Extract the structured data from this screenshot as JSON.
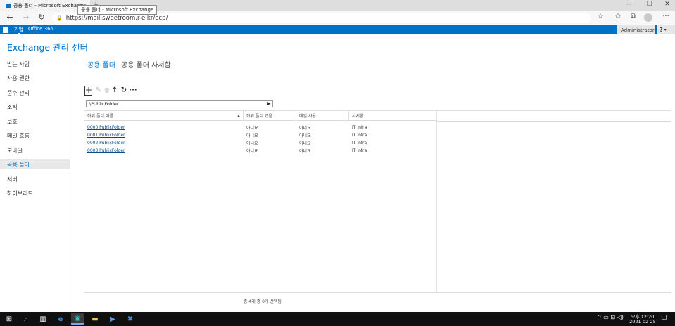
{
  "browser": {
    "tab_title": "공용 폴더 - Microsoft Exchange",
    "tooltip": "공용 폴더 - Microsoft Exchange",
    "url": "https://mail.sweetroom.r-e.kr/ecp/"
  },
  "o365": {
    "enterprise": "기업",
    "office": "Office 365",
    "user": "Administrator",
    "help": "?"
  },
  "app": {
    "title": "Exchange 관리 센터"
  },
  "nav": {
    "items": [
      {
        "label": "받는 사람"
      },
      {
        "label": "사용 권한"
      },
      {
        "label": "준수 관리"
      },
      {
        "label": "조직"
      },
      {
        "label": "보호"
      },
      {
        "label": "메일 흐름"
      },
      {
        "label": "모바일"
      },
      {
        "label": "공용 폴더"
      },
      {
        "label": "서버"
      },
      {
        "label": "하이브리드"
      }
    ],
    "active_index": 7
  },
  "tabs": {
    "public_folders": "공용 폴더",
    "public_mailboxes": "공용 폴더 사서함"
  },
  "toolbar": {
    "add": "+",
    "edit": "✎",
    "delete": "🗑",
    "up": "↑",
    "refresh": "↻",
    "more": "···"
  },
  "breadcrumb": "\\PublicFolder",
  "grid": {
    "columns": [
      "하위 폴더 이름",
      "하위 폴더 있음",
      "메일 사용",
      "사서함"
    ],
    "rows": [
      [
        "0000 PublicFolder",
        "아니요",
        "아니요",
        "IT Infra"
      ],
      [
        "0001 PublicFolder",
        "아니요",
        "아니요",
        "IT Infra"
      ],
      [
        "0002 PublicFolder",
        "아니요",
        "아니요",
        "IT Infra"
      ],
      [
        "0003 PublicFolder",
        "아니요",
        "아니요",
        "IT Infra"
      ]
    ]
  },
  "status": "총 4개 중 0개 선택됨",
  "taskbar": {
    "time": "오후 12:20",
    "date": "2021-02-25"
  }
}
